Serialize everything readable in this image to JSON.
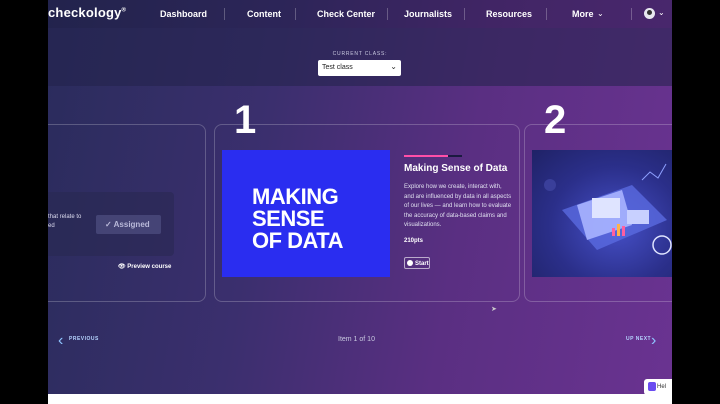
{
  "nav": {
    "logo": "checkology",
    "logo_mark": "®",
    "items": [
      "Dashboard",
      "Content",
      "Check Center",
      "Journalists",
      "Resources",
      "More"
    ]
  },
  "class_selector": {
    "label": "CURRENT CLASS:",
    "value": "Test class"
  },
  "cards": {
    "prev_card": {
      "text": "that relate to\ned",
      "status": "Assigned",
      "preview": "Preview course"
    },
    "item1": {
      "number": "1",
      "thumb_lines": [
        "MAKING",
        "SENSE",
        "OF DATA"
      ],
      "title": "Making Sense of Data",
      "description": "Explore how we create, interact with, and are influenced by data in all aspects of our lives — and learn how to evaluate the accuracy of data-based claims and visualizations.",
      "points": "210pts",
      "start": "Start"
    },
    "item2": {
      "number": "2"
    }
  },
  "pagination": {
    "previous": "PREVIOUS",
    "status": "Item 1 of 10",
    "next": "UP NEXT"
  },
  "help": {
    "label": "Hel"
  },
  "colors": {
    "accent_pink": "#ff4fa8",
    "thumb_blue": "#2a2df0",
    "link_blue": "#8ec5ff"
  }
}
